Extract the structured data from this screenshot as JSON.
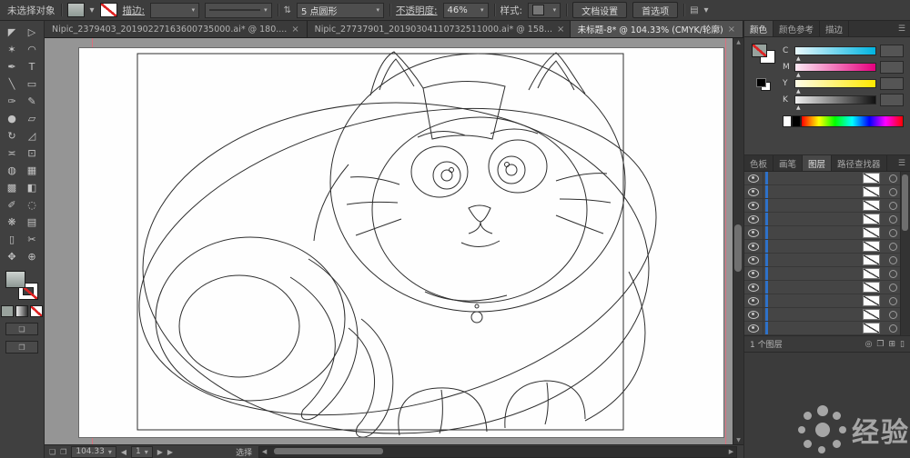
{
  "control_bar": {
    "selection_status": "未选择对象",
    "stroke_label": "描边:",
    "brush_value": "5 点圆形",
    "opacity_label": "不透明度:",
    "opacity_value": "46%",
    "style_label": "样式:",
    "doc_setup_label": "文档设置",
    "preferences_label": "首选项"
  },
  "tab_bar": {
    "tabs": [
      {
        "label": "Nipic_2379403_20190227163600735000.ai* @ 180...."
      },
      {
        "label": "Nipic_27737901_20190304110732511000.ai* @ 158..."
      },
      {
        "label": "未标题-8* @ 104.33% (CMYK/轮廓)"
      }
    ]
  },
  "toolbar": {
    "tools": [
      {
        "name": "selection",
        "glyph": "◤"
      },
      {
        "name": "direct-selection",
        "glyph": "▷"
      },
      {
        "name": "magic-wand",
        "glyph": "✶"
      },
      {
        "name": "lasso",
        "glyph": "◠"
      },
      {
        "name": "pen",
        "glyph": "✒"
      },
      {
        "name": "type",
        "glyph": "T"
      },
      {
        "name": "line-segment",
        "glyph": "╲"
      },
      {
        "name": "rectangle",
        "glyph": "▭"
      },
      {
        "name": "paintbrush",
        "glyph": "✑"
      },
      {
        "name": "pencil",
        "glyph": "✎"
      },
      {
        "name": "blob-brush",
        "glyph": "●"
      },
      {
        "name": "eraser",
        "glyph": "▱"
      },
      {
        "name": "rotate",
        "glyph": "↻"
      },
      {
        "name": "scale",
        "glyph": "◿"
      },
      {
        "name": "width",
        "glyph": "≍"
      },
      {
        "name": "free-transform",
        "glyph": "⊡"
      },
      {
        "name": "shape-builder",
        "glyph": "◍"
      },
      {
        "name": "perspective-grid",
        "glyph": "▦"
      },
      {
        "name": "mesh",
        "glyph": "▩"
      },
      {
        "name": "gradient",
        "glyph": "◧"
      },
      {
        "name": "eyedropper",
        "glyph": "✐"
      },
      {
        "name": "blend",
        "glyph": "◌"
      },
      {
        "name": "symbol-sprayer",
        "glyph": "❋"
      },
      {
        "name": "column-graph",
        "glyph": "▤"
      },
      {
        "name": "artboard",
        "glyph": "▯"
      },
      {
        "name": "slice",
        "glyph": "✂"
      },
      {
        "name": "hand",
        "glyph": "✥"
      },
      {
        "name": "zoom",
        "glyph": "⊕"
      }
    ]
  },
  "color_panel": {
    "tab_color": "颜色",
    "tab_color_guide": "颜色参考",
    "tab_stroke": "描边",
    "channels": [
      {
        "label": "C"
      },
      {
        "label": "M"
      },
      {
        "label": "Y"
      },
      {
        "label": "K"
      }
    ]
  },
  "panel_group": {
    "tab_swatches": "色板",
    "tab_brushes": "画笔",
    "tab_layers": "图层",
    "tab_pathfinder": "路径查找器"
  },
  "layers_panel": {
    "row_count": 12,
    "layer_count_text": "1 个图层"
  },
  "status_bar": {
    "zoom_value": "104.33",
    "artboard_number": "1",
    "tool_status": "选择"
  },
  "watermark": {
    "text": "经验"
  },
  "icons": {
    "close": "×",
    "dropdown": "▾",
    "spinner": "⇅",
    "menu": "☰",
    "left_arrow": "◀",
    "right_arrow": "▶",
    "up_arrow": "▲",
    "down_arrow": "▼",
    "mask_icon": "◎",
    "new_sublayer_icon": "❐",
    "new_layer_icon": "⊞",
    "trash_icon": "▯",
    "doc_a": "❏",
    "doc_b": "❐",
    "panel_options": "▤"
  }
}
